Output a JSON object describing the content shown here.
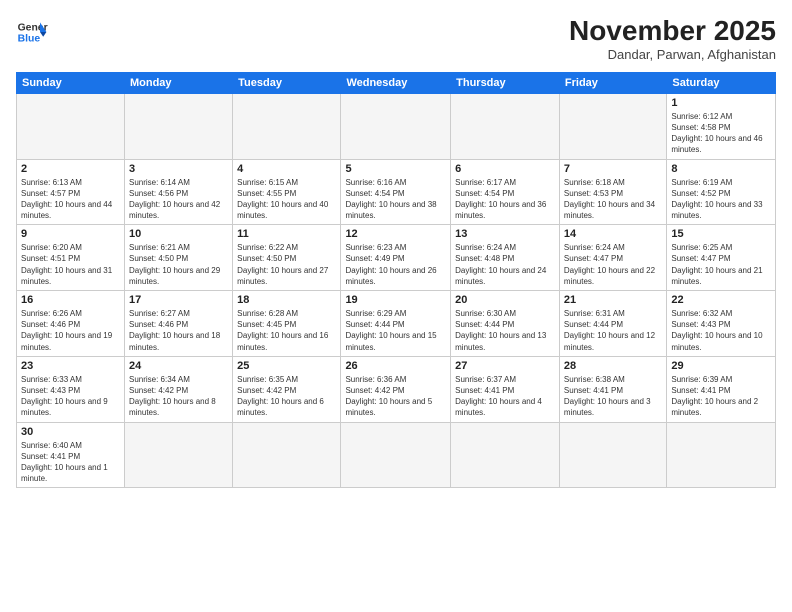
{
  "logo": {
    "text_general": "General",
    "text_blue": "Blue"
  },
  "title": "November 2025",
  "subtitle": "Dandar, Parwan, Afghanistan",
  "weekdays": [
    "Sunday",
    "Monday",
    "Tuesday",
    "Wednesday",
    "Thursday",
    "Friday",
    "Saturday"
  ],
  "weeks": [
    [
      {
        "day": "",
        "info": ""
      },
      {
        "day": "",
        "info": ""
      },
      {
        "day": "",
        "info": ""
      },
      {
        "day": "",
        "info": ""
      },
      {
        "day": "",
        "info": ""
      },
      {
        "day": "",
        "info": ""
      },
      {
        "day": "1",
        "info": "Sunrise: 6:12 AM\nSunset: 4:58 PM\nDaylight: 10 hours and 46 minutes."
      }
    ],
    [
      {
        "day": "2",
        "info": "Sunrise: 6:13 AM\nSunset: 4:57 PM\nDaylight: 10 hours and 44 minutes."
      },
      {
        "day": "3",
        "info": "Sunrise: 6:14 AM\nSunset: 4:56 PM\nDaylight: 10 hours and 42 minutes."
      },
      {
        "day": "4",
        "info": "Sunrise: 6:15 AM\nSunset: 4:55 PM\nDaylight: 10 hours and 40 minutes."
      },
      {
        "day": "5",
        "info": "Sunrise: 6:16 AM\nSunset: 4:54 PM\nDaylight: 10 hours and 38 minutes."
      },
      {
        "day": "6",
        "info": "Sunrise: 6:17 AM\nSunset: 4:54 PM\nDaylight: 10 hours and 36 minutes."
      },
      {
        "day": "7",
        "info": "Sunrise: 6:18 AM\nSunset: 4:53 PM\nDaylight: 10 hours and 34 minutes."
      },
      {
        "day": "8",
        "info": "Sunrise: 6:19 AM\nSunset: 4:52 PM\nDaylight: 10 hours and 33 minutes."
      }
    ],
    [
      {
        "day": "9",
        "info": "Sunrise: 6:20 AM\nSunset: 4:51 PM\nDaylight: 10 hours and 31 minutes."
      },
      {
        "day": "10",
        "info": "Sunrise: 6:21 AM\nSunset: 4:50 PM\nDaylight: 10 hours and 29 minutes."
      },
      {
        "day": "11",
        "info": "Sunrise: 6:22 AM\nSunset: 4:50 PM\nDaylight: 10 hours and 27 minutes."
      },
      {
        "day": "12",
        "info": "Sunrise: 6:23 AM\nSunset: 4:49 PM\nDaylight: 10 hours and 26 minutes."
      },
      {
        "day": "13",
        "info": "Sunrise: 6:24 AM\nSunset: 4:48 PM\nDaylight: 10 hours and 24 minutes."
      },
      {
        "day": "14",
        "info": "Sunrise: 6:24 AM\nSunset: 4:47 PM\nDaylight: 10 hours and 22 minutes."
      },
      {
        "day": "15",
        "info": "Sunrise: 6:25 AM\nSunset: 4:47 PM\nDaylight: 10 hours and 21 minutes."
      }
    ],
    [
      {
        "day": "16",
        "info": "Sunrise: 6:26 AM\nSunset: 4:46 PM\nDaylight: 10 hours and 19 minutes."
      },
      {
        "day": "17",
        "info": "Sunrise: 6:27 AM\nSunset: 4:46 PM\nDaylight: 10 hours and 18 minutes."
      },
      {
        "day": "18",
        "info": "Sunrise: 6:28 AM\nSunset: 4:45 PM\nDaylight: 10 hours and 16 minutes."
      },
      {
        "day": "19",
        "info": "Sunrise: 6:29 AM\nSunset: 4:44 PM\nDaylight: 10 hours and 15 minutes."
      },
      {
        "day": "20",
        "info": "Sunrise: 6:30 AM\nSunset: 4:44 PM\nDaylight: 10 hours and 13 minutes."
      },
      {
        "day": "21",
        "info": "Sunrise: 6:31 AM\nSunset: 4:44 PM\nDaylight: 10 hours and 12 minutes."
      },
      {
        "day": "22",
        "info": "Sunrise: 6:32 AM\nSunset: 4:43 PM\nDaylight: 10 hours and 10 minutes."
      }
    ],
    [
      {
        "day": "23",
        "info": "Sunrise: 6:33 AM\nSunset: 4:43 PM\nDaylight: 10 hours and 9 minutes."
      },
      {
        "day": "24",
        "info": "Sunrise: 6:34 AM\nSunset: 4:42 PM\nDaylight: 10 hours and 8 minutes."
      },
      {
        "day": "25",
        "info": "Sunrise: 6:35 AM\nSunset: 4:42 PM\nDaylight: 10 hours and 6 minutes."
      },
      {
        "day": "26",
        "info": "Sunrise: 6:36 AM\nSunset: 4:42 PM\nDaylight: 10 hours and 5 minutes."
      },
      {
        "day": "27",
        "info": "Sunrise: 6:37 AM\nSunset: 4:41 PM\nDaylight: 10 hours and 4 minutes."
      },
      {
        "day": "28",
        "info": "Sunrise: 6:38 AM\nSunset: 4:41 PM\nDaylight: 10 hours and 3 minutes."
      },
      {
        "day": "29",
        "info": "Sunrise: 6:39 AM\nSunset: 4:41 PM\nDaylight: 10 hours and 2 minutes."
      }
    ],
    [
      {
        "day": "30",
        "info": "Sunrise: 6:40 AM\nSunset: 4:41 PM\nDaylight: 10 hours and 1 minute."
      },
      {
        "day": "",
        "info": ""
      },
      {
        "day": "",
        "info": ""
      },
      {
        "day": "",
        "info": ""
      },
      {
        "day": "",
        "info": ""
      },
      {
        "day": "",
        "info": ""
      },
      {
        "day": "",
        "info": ""
      }
    ]
  ]
}
